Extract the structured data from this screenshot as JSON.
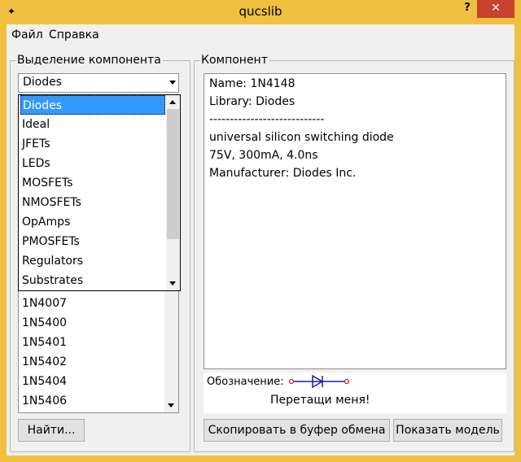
{
  "window": {
    "title": "qucslib",
    "help_glyph": "?",
    "close_glyph": "✕"
  },
  "menu": {
    "file": "Файл",
    "help": "Справка"
  },
  "left_group": {
    "legend": "Выделение компонента",
    "combo_value": "Diodes",
    "dropdown_items": [
      "Diodes",
      "Ideal",
      "JFETs",
      "LEDs",
      "MOSFETs",
      "NMOSFETs",
      "OpAmps",
      "PMOSFETs",
      "Regulators",
      "Substrates"
    ],
    "selected_index": 0,
    "list_items": [
      "1N4007",
      "1N5400",
      "1N5401",
      "1N5402",
      "1N5404",
      "1N5406"
    ],
    "find_button": "Найти..."
  },
  "right_group": {
    "legend": "Компонент",
    "info_lines": [
      "Name: 1N4148",
      "Library: Diodes",
      "----------------------------",
      "universal silicon switching diode",
      "75V, 300mA, 4.0ns",
      "Manufacturer: Diodes Inc."
    ],
    "symbol_label": "Обозначение:",
    "drag_hint": "Перетащи меня!",
    "copy_button": "Скопировать в буфер обмена",
    "show_model_button": "Показать модель"
  },
  "colors": {
    "frame": "#f0c040",
    "selection": "#3399ff",
    "close": "#c9412f",
    "diode": "#1a1ab0",
    "pin": "#c02020"
  }
}
